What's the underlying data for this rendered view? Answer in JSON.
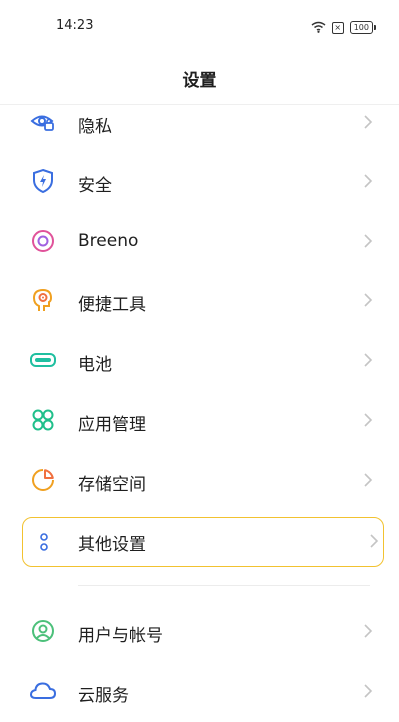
{
  "status_bar": {
    "time": "14:23",
    "battery": "100",
    "sim_glyph": "×",
    "icons": [
      "wifi-icon",
      "sim-icon",
      "battery-icon"
    ]
  },
  "header": {
    "title": "设置"
  },
  "colors": {
    "privacy": "#3a6ee0",
    "security": "#3a6ee0",
    "breeno": "#e0529a",
    "tools": "#f0a020",
    "battery": "#1fbfa0",
    "apps": "#1fbf8a",
    "storage": "#f07040",
    "other": "#3a6ee0",
    "account": "#4cc07a",
    "cloud": "#3a6ee0",
    "highlight_border": "#f2c230"
  },
  "settings": {
    "items": [
      {
        "label": "隐私",
        "icon": "privacy-eye-icon"
      },
      {
        "label": "安全",
        "icon": "shield-icon"
      },
      {
        "label": "Breeno",
        "icon": "breeno-ring-icon"
      },
      {
        "label": "便捷工具",
        "icon": "smart-tools-icon"
      },
      {
        "label": "电池",
        "icon": "battery-icon"
      },
      {
        "label": "应用管理",
        "icon": "apps-grid-icon"
      },
      {
        "label": "存储空间",
        "icon": "storage-pie-icon"
      },
      {
        "label": "其他设置",
        "icon": "other-dots-icon"
      },
      {
        "label": "用户与帐号",
        "icon": "user-account-icon"
      },
      {
        "label": "云服务",
        "icon": "cloud-icon"
      }
    ]
  }
}
